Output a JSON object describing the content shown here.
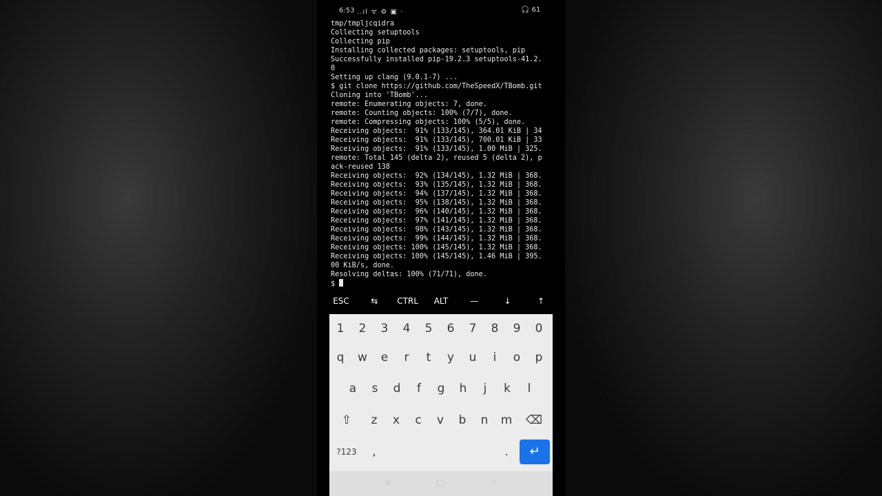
{
  "status_bar": {
    "time": "6:53",
    "signal": "..ıl ᯤ ⚙ ▣ ·",
    "right": "🎧 61"
  },
  "terminal": {
    "lines": [
      "tmp/tmpljcqidra",
      "Collecting setuptools",
      "Collecting pip",
      "Installing collected packages: setuptools, pip",
      "Successfully installed pip-19.2.3 setuptools-41.2.",
      "0",
      "Setting up clang (9.0.1-7) ...",
      "$ git clone https://github.com/TheSpeedX/TBomb.git",
      "Cloning into 'TBomb'...",
      "remote: Enumerating objects: 7, done.",
      "remote: Counting objects: 100% (7/7), done.",
      "remote: Compressing objects: 100% (5/5), done.",
      "Receiving objects:  91% (133/145), 364.01 KiB | 34",
      "Receiving objects:  91% (133/145), 700.01 KiB | 33",
      "Receiving objects:  91% (133/145), 1.00 MiB | 325.",
      "remote: Total 145 (delta 2), reused 5 (delta 2), p",
      "ack-reused 138",
      "Receiving objects:  92% (134/145), 1.32 MiB | 368.",
      "Receiving objects:  93% (135/145), 1.32 MiB | 368.",
      "Receiving objects:  94% (137/145), 1.32 MiB | 368.",
      "Receiving objects:  95% (138/145), 1.32 MiB | 368.",
      "Receiving objects:  96% (140/145), 1.32 MiB | 368.",
      "Receiving objects:  97% (141/145), 1.32 MiB | 368.",
      "Receiving objects:  98% (143/145), 1.32 MiB | 368.",
      "Receiving objects:  99% (144/145), 1.32 MiB | 368.",
      "Receiving objects: 100% (145/145), 1.32 MiB | 368.",
      "Receiving objects: 100% (145/145), 1.46 MiB | 395.",
      "00 KiB/s, done.",
      "Resolving deltas: 100% (71/71), done."
    ],
    "prompt": "$ "
  },
  "extra_keys": [
    "ESC",
    "⇆",
    "CTRL",
    "ALT",
    "—",
    "↓",
    "↑"
  ],
  "keyboard": {
    "row_numbers": [
      "1",
      "2",
      "3",
      "4",
      "5",
      "6",
      "7",
      "8",
      "9",
      "0"
    ],
    "row1": [
      "q",
      "w",
      "e",
      "r",
      "t",
      "y",
      "u",
      "i",
      "o",
      "p"
    ],
    "row2": [
      "a",
      "s",
      "d",
      "f",
      "g",
      "h",
      "j",
      "k",
      "l"
    ],
    "row3": [
      "z",
      "x",
      "c",
      "v",
      "b",
      "n",
      "m"
    ],
    "shift": "⇧",
    "backspace": "⌫",
    "symbols": "?123",
    "comma": ",",
    "period": ".",
    "enter": "↵",
    "nav": [
      "≡",
      "□",
      "◁"
    ]
  }
}
